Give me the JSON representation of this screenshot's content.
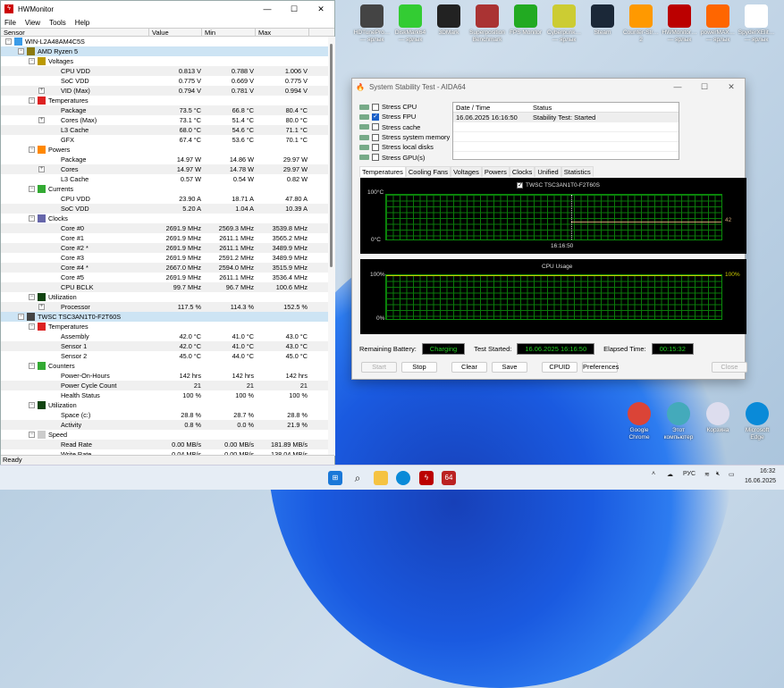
{
  "hwmonitor": {
    "title": "HWMonitor",
    "menu": [
      "File",
      "View",
      "Tools",
      "Help"
    ],
    "columns": [
      "Sensor",
      "Value",
      "Min",
      "Max"
    ],
    "status": "Ready",
    "rows": [
      {
        "lvl": 0,
        "label": "WIN-L2A48AM4C5S",
        "icon": "computer-icon",
        "exp": "-"
      },
      {
        "lvl": 1,
        "label": "AMD Ryzen 5",
        "icon": "cpu-chip-icon",
        "exp": "-",
        "sel": true
      },
      {
        "lvl": 2,
        "label": "Voltages",
        "icon": "voltage-icon",
        "exp": "-"
      },
      {
        "lvl": 3,
        "label": "CPU VDD",
        "value": "0.813 V",
        "min": "0.788 V",
        "max": "1.006 V"
      },
      {
        "lvl": 3,
        "label": "SoC VDD",
        "value": "0.775 V",
        "min": "0.669 V",
        "max": "0.775 V"
      },
      {
        "lvl": 3,
        "label": "VID (Max)",
        "value": "0.794 V",
        "min": "0.781 V",
        "max": "0.994 V",
        "exp": "+"
      },
      {
        "lvl": 2,
        "label": "Temperatures",
        "icon": "thermometer-icon",
        "exp": "-"
      },
      {
        "lvl": 3,
        "label": "Package",
        "value": "73.5 °C",
        "min": "66.8 °C",
        "max": "80.4 °C"
      },
      {
        "lvl": 3,
        "label": "Cores (Max)",
        "value": "73.1 °C",
        "min": "51.4 °C",
        "max": "80.0 °C",
        "exp": "+"
      },
      {
        "lvl": 3,
        "label": "L3 Cache",
        "value": "68.0 °C",
        "min": "54.6 °C",
        "max": "71.1 °C"
      },
      {
        "lvl": 3,
        "label": "GFX",
        "value": "67.4 °C",
        "min": "53.6 °C",
        "max": "70.1 °C"
      },
      {
        "lvl": 2,
        "label": "Powers",
        "icon": "power-flame-icon",
        "exp": "-"
      },
      {
        "lvl": 3,
        "label": "Package",
        "value": "14.97 W",
        "min": "14.86 W",
        "max": "29.97 W"
      },
      {
        "lvl": 3,
        "label": "Cores",
        "value": "14.97 W",
        "min": "14.78 W",
        "max": "29.97 W",
        "exp": "+"
      },
      {
        "lvl": 3,
        "label": "L3 Cache",
        "value": "0.57 W",
        "min": "0.54 W",
        "max": "0.82 W"
      },
      {
        "lvl": 2,
        "label": "Currents",
        "icon": "current-icon",
        "exp": "-"
      },
      {
        "lvl": 3,
        "label": "CPU VDD",
        "value": "23.90 A",
        "min": "18.71 A",
        "max": "47.80 A"
      },
      {
        "lvl": 3,
        "label": "SoC VDD",
        "value": "5.20 A",
        "min": "1.04 A",
        "max": "10.39 A"
      },
      {
        "lvl": 2,
        "label": "Clocks",
        "icon": "clock-chip-icon",
        "exp": "-"
      },
      {
        "lvl": 3,
        "label": "Core #0",
        "value": "2691.9 MHz",
        "min": "2569.3 MHz",
        "max": "3539.8 MHz"
      },
      {
        "lvl": 3,
        "label": "Core #1",
        "value": "2691.9 MHz",
        "min": "2611.1 MHz",
        "max": "3565.2 MHz"
      },
      {
        "lvl": 3,
        "label": "Core #2 *",
        "value": "2691.9 MHz",
        "min": "2611.1 MHz",
        "max": "3489.9 MHz"
      },
      {
        "lvl": 3,
        "label": "Core #3",
        "value": "2691.9 MHz",
        "min": "2591.2 MHz",
        "max": "3489.9 MHz"
      },
      {
        "lvl": 3,
        "label": "Core #4 *",
        "value": "2667.0 MHz",
        "min": "2594.0 MHz",
        "max": "3515.9 MHz"
      },
      {
        "lvl": 3,
        "label": "Core #5",
        "value": "2691.9 MHz",
        "min": "2611.1 MHz",
        "max": "3536.4 MHz"
      },
      {
        "lvl": 3,
        "label": "CPU BCLK",
        "value": "99.7 MHz",
        "min": "96.7 MHz",
        "max": "100.6 MHz"
      },
      {
        "lvl": 2,
        "label": "Utilization",
        "icon": "utilization-icon",
        "exp": "-"
      },
      {
        "lvl": 3,
        "label": "Processor",
        "value": "117.5 %",
        "min": "114.3 %",
        "max": "152.5 %",
        "exp": "+"
      },
      {
        "lvl": 1,
        "label": "TWSC TSC3AN1T0-F2T60S",
        "icon": "drive-icon",
        "exp": "-",
        "sel": true
      },
      {
        "lvl": 2,
        "label": "Temperatures",
        "icon": "thermometer-icon",
        "exp": "-"
      },
      {
        "lvl": 3,
        "label": "Assembly",
        "value": "42.0 °C",
        "min": "41.0 °C",
        "max": "43.0 °C"
      },
      {
        "lvl": 3,
        "label": "Sensor 1",
        "value": "42.0 °C",
        "min": "41.0 °C",
        "max": "43.0 °C"
      },
      {
        "lvl": 3,
        "label": "Sensor 2",
        "value": "45.0 °C",
        "min": "44.0 °C",
        "max": "45.0 °C"
      },
      {
        "lvl": 2,
        "label": "Counters",
        "icon": "counter-icon",
        "exp": "-"
      },
      {
        "lvl": 3,
        "label": "Power-On-Hours",
        "value": "142 hrs",
        "min": "142 hrs",
        "max": "142 hrs"
      },
      {
        "lvl": 3,
        "label": "Power Cycle Count",
        "value": "21",
        "min": "21",
        "max": "21"
      },
      {
        "lvl": 3,
        "label": "Health Status",
        "value": "100 %",
        "min": "100 %",
        "max": "100 %"
      },
      {
        "lvl": 2,
        "label": "Utilization",
        "icon": "utilization-icon",
        "exp": "-"
      },
      {
        "lvl": 3,
        "label": "Space (c:)",
        "value": "28.8 %",
        "min": "28.7 %",
        "max": "28.8 %"
      },
      {
        "lvl": 3,
        "label": "Activity",
        "value": "0.8 %",
        "min": "0.0 %",
        "max": "21.9 %"
      },
      {
        "lvl": 2,
        "label": "Speed",
        "icon": "speed-gauge-icon",
        "exp": "-"
      },
      {
        "lvl": 3,
        "label": "Read Rate",
        "value": "0.00 MB/s",
        "min": "0.00 MB/s",
        "max": "181.89 MB/s"
      },
      {
        "lvl": 3,
        "label": "Write Rate",
        "value": "0.04 MB/s",
        "min": "0.00 MB/s",
        "max": "138.04 MB/s"
      }
    ]
  },
  "aida": {
    "title": "System Stability Test - AIDA64",
    "stress": [
      {
        "label": "Stress CPU",
        "checked": false
      },
      {
        "label": "Stress FPU",
        "checked": true
      },
      {
        "label": "Stress cache",
        "checked": false
      },
      {
        "label": "Stress system memory",
        "checked": false
      },
      {
        "label": "Stress local disks",
        "checked": false
      },
      {
        "label": "Stress GPU(s)",
        "checked": false
      }
    ],
    "log_headers": [
      "Date / Time",
      "Status"
    ],
    "log": [
      {
        "time": "16.06.2025 16:16:50",
        "status": "Stability Test: Started"
      }
    ],
    "tabs": [
      "Temperatures",
      "Cooling Fans",
      "Voltages",
      "Powers",
      "Clocks",
      "Unified",
      "Statistics"
    ],
    "temp_graph": {
      "legend": "TWSC TSC3AN1T0-F2T60S",
      "ymax": "100°C",
      "ymin": "0°C",
      "xlabel": "16:16:50",
      "current": "42",
      "value": 42
    },
    "cpu_graph": {
      "title": "CPU Usage",
      "ymax": "100%",
      "ymin": "0%",
      "current": "100%",
      "value": 100
    },
    "battery_label": "Remaining Battery:",
    "battery": "Charging",
    "started_label": "Test Started:",
    "started": "16.06.2025 16:16:50",
    "elapsed_label": "Elapsed Time:",
    "elapsed": "00:15:32",
    "buttons": {
      "start": "Start",
      "stop": "Stop",
      "clear": "Clear",
      "save": "Save",
      "cpuid": "CPUID",
      "prefs": "Preferences",
      "close": "Close"
    }
  },
  "desktop": {
    "icons": [
      {
        "label": "HDTunePro… — ярлык",
        "color": "#444"
      },
      {
        "label": "DiskMark64 — ярлык",
        "color": "#3c3"
      },
      {
        "label": "3DMark",
        "color": "#222"
      },
      {
        "label": "Superposition Benchmark",
        "color": "#a33"
      },
      {
        "label": "FPS Monitor",
        "color": "#2a2"
      },
      {
        "label": "Cyberpunk… — ярлык",
        "color": "#cc3"
      },
      {
        "label": "Steam",
        "color": "#1b2838"
      },
      {
        "label": "Counter-Str… 2",
        "color": "#f90"
      },
      {
        "label": "HWMonitor… — ярлык",
        "color": "#b00"
      },
      {
        "label": "powerMAX… — ярлык",
        "color": "#f60"
      },
      {
        "label": "SpyderXElit… — ярлык",
        "color": "#fff"
      }
    ],
    "bottom_icons": [
      {
        "label": "Google Chrome",
        "color": "#db4437"
      },
      {
        "label": "Этот компьютер",
        "color": "#4ab"
      },
      {
        "label": "Корзина",
        "color": "#dde"
      },
      {
        "label": "Microsoft Edge",
        "color": "#0a8ad8"
      }
    ]
  },
  "taskbar": {
    "lang": "РУС",
    "time": "16:32",
    "date": "16.06.2025"
  }
}
